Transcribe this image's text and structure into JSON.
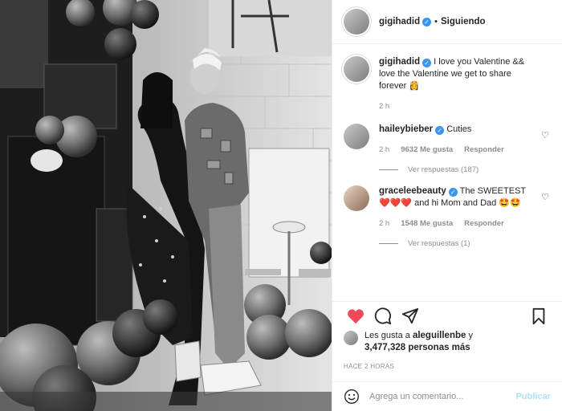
{
  "post": {
    "username": "gigihadid",
    "verified_badge": "✓",
    "separator": "•",
    "follow_status": "Siguiendo"
  },
  "caption": {
    "username": "gigihadid",
    "text": "I love you Valentine && love the Valentine we get to share forever",
    "emoji": "👸",
    "time": "2 h"
  },
  "comments": [
    {
      "username": "haileybieber",
      "text": "Cuties",
      "time": "2 h",
      "likes": "9632 Me gusta",
      "reply_label": "Responder",
      "view_replies": "Ver respuestas (187)"
    },
    {
      "username": "graceleebeauty",
      "text": "The SWEETEST",
      "emoji_line1": "❤️❤️❤️",
      "text_line2": "and hi Mom and Dad",
      "emoji_line3": "🤩🤩",
      "time": "2 h",
      "likes": "1548 Me gusta",
      "reply_label": "Responder",
      "view_replies": "Ver respuestas (1)"
    }
  ],
  "likes": {
    "prefix": "Les gusta a",
    "user": "aleguillenbe",
    "conj": "y",
    "count": "3,477,328 personas más"
  },
  "timestamp": "HACE 2 HORAS",
  "add_comment": {
    "placeholder": "Agrega un comentario...",
    "publish": "Publicar"
  },
  "icons": {
    "like": "heart-filled-icon",
    "comment": "comment-icon",
    "share": "share-icon",
    "save": "bookmark-icon",
    "emoji": "smiley-icon"
  },
  "colors": {
    "like": "#ed4956",
    "verified": "#3897f0",
    "publish": "#b2dffc"
  }
}
